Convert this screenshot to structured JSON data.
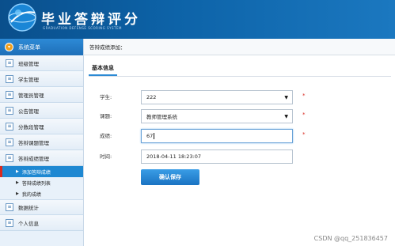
{
  "header": {
    "title": "毕业答辩评分",
    "subtitle": "GRADUATION DEFENSE SCORING SYSTEM"
  },
  "sidebar": {
    "heading": "系统菜单",
    "items": [
      {
        "label": "班级管理",
        "icon": "list-icon"
      },
      {
        "label": "学生管理",
        "icon": "list-icon"
      },
      {
        "label": "管理员管理",
        "icon": "list-icon"
      },
      {
        "label": "公告管理",
        "icon": "list-icon"
      },
      {
        "label": "分数段管理",
        "icon": "list-icon"
      },
      {
        "label": "答辩课题管理",
        "icon": "list-icon"
      },
      {
        "label": "答辩成绩管理",
        "icon": "list-icon"
      }
    ],
    "sub_items": [
      {
        "label": "添加答辩成绩",
        "active": true
      },
      {
        "label": "答辩成绩列表",
        "active": false
      },
      {
        "label": "我的成绩",
        "active": false
      }
    ],
    "items_after": [
      {
        "label": "数据统计",
        "icon": "list-icon"
      },
      {
        "label": "个人信息",
        "icon": "list-icon"
      }
    ]
  },
  "main": {
    "breadcrumb": "答辩成绩添加：",
    "section_title": "基本信息",
    "form": {
      "student_label": "学生:",
      "student_value": "222",
      "topic_label": "课题:",
      "topic_value": "教师管理系统",
      "score_label": "成绩:",
      "score_value": "67",
      "time_label": "时间:",
      "time_value": "2018-04-11 18:23:07",
      "required_mark": "*"
    },
    "save_label": "确认保存"
  },
  "watermark": "CSDN @qq_251836457",
  "colors": {
    "header_blue": "#0d63a8",
    "active_item": "#1e88d2",
    "required": "#d9291f",
    "button": "#1a73c2"
  }
}
